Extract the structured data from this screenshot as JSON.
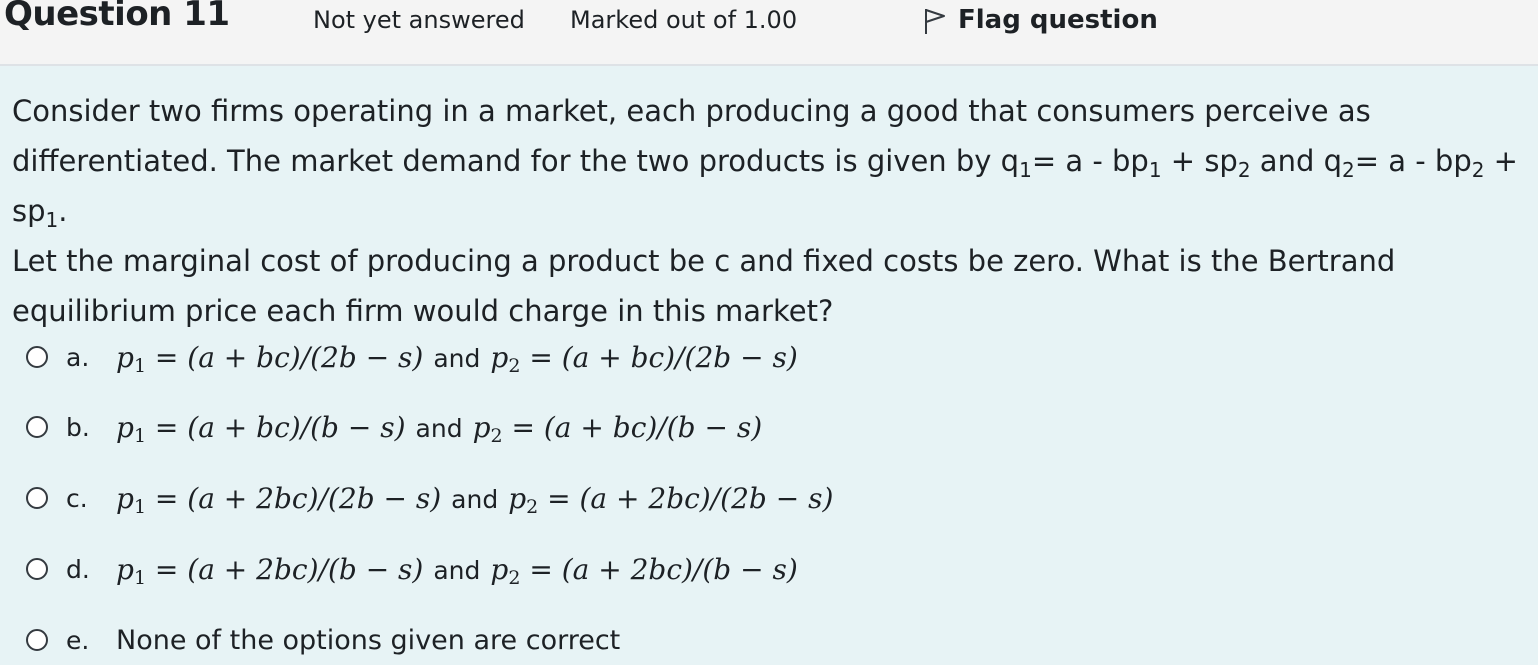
{
  "header": {
    "question_number": "Question 11",
    "state": "Not yet answered",
    "grade": "Marked out of 1.00",
    "flag_label": "Flag question",
    "flag_icon": "flag-outline-icon"
  },
  "question": {
    "line1": "Consider two firms operating in a market, each producing a good that consumers perceive as",
    "line2_a": "differentiated. The market demand for the two products is given by q",
    "sub1": "1",
    "line2_b": "= a - bp",
    "sub2": "1",
    "line2_c": " + sp",
    "sub3": "2",
    "line2_d": " and q",
    "sub4": "2",
    "line2_e": "= a - bp",
    "sub5": "2",
    "line2_f": " + sp",
    "sub6": "1",
    "line2_g": ".",
    "line3": "Let the marginal cost of producing a product be c and fixed costs be zero. What is the Bertrand",
    "line4": "equilibrium price each firm would charge in this market?"
  },
  "options": [
    {
      "letter": "a.",
      "p1_expr": " = (a + bc)/(2b − s)",
      "and": "and",
      "p2_expr": " = (a + bc)/(2b − s)"
    },
    {
      "letter": "b.",
      "p1_expr": " = (a + bc)/(b − s)",
      "and": "and",
      "p2_expr": " = (a + bc)/(b − s)"
    },
    {
      "letter": "c.",
      "p1_expr": " = (a + 2bc)/(2b − s)",
      "and": "and",
      "p2_expr": " = (a + 2bc)/(2b − s)"
    },
    {
      "letter": "d.",
      "p1_expr": " = (a + 2bc)/(b − s)",
      "and": "and",
      "p2_expr": " = (a + 2bc)/(b − s)"
    },
    {
      "letter": "e.",
      "text": "None of the options given are correct"
    }
  ],
  "math": {
    "p": "p",
    "sub1": "1",
    "sub2": "2"
  }
}
